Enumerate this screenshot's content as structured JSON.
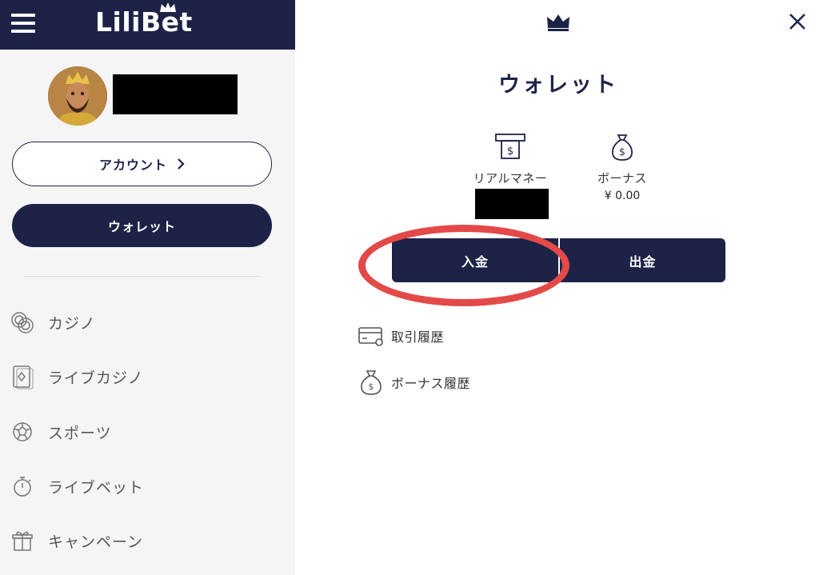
{
  "header": {
    "logo_text": "LiliBet",
    "menu_icon": "hamburger-menu-icon",
    "close_icon": "close-icon",
    "crown_icon": "crown-icon"
  },
  "sidebar": {
    "avatar_icon": "avatar",
    "account_button": "アカウント",
    "wallet_button": "ウォレット",
    "nav_items": [
      {
        "label": "カジノ",
        "icon": "casino-chips-icon"
      },
      {
        "label": "ライブカジノ",
        "icon": "playing-card-icon"
      },
      {
        "label": "スポーツ",
        "icon": "soccer-ball-icon"
      },
      {
        "label": "ライブベット",
        "icon": "stopwatch-icon"
      },
      {
        "label": "キャンペーン",
        "icon": "gift-icon"
      }
    ]
  },
  "wallet": {
    "title": "ウォレット",
    "real_money_label": "リアルマネー",
    "bonus_label": "ボーナス",
    "bonus_value": "¥ 0.00",
    "deposit_button": "入金",
    "withdraw_button": "出金",
    "links": [
      {
        "label": "取引履歴",
        "icon": "credit-card-icon"
      },
      {
        "label": "ボーナス履歴",
        "icon": "money-bag-icon"
      }
    ]
  },
  "colors": {
    "navy": "#1d2347",
    "sidebar_bg": "#f5f5f5",
    "highlight": "#e34948"
  }
}
